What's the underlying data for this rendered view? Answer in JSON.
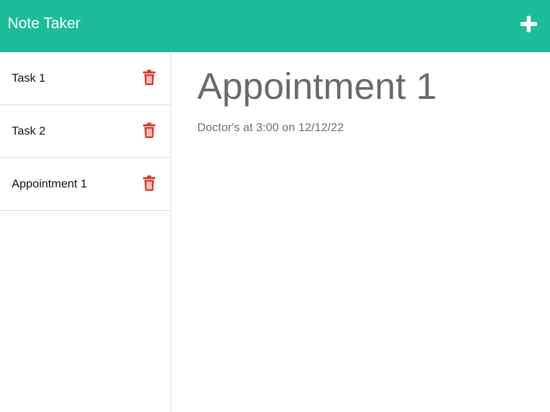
{
  "app": {
    "brand": "Note Taker",
    "new_note_icon": "plus-icon",
    "accent_color": "#1cbc9b",
    "delete_color": "#e03c2c"
  },
  "notes": [
    {
      "title": "Task 1",
      "delete_icon": "trash-icon"
    },
    {
      "title": "Task 2",
      "delete_icon": "trash-icon"
    },
    {
      "title": "Appointment 1",
      "delete_icon": "trash-icon"
    }
  ],
  "active_note": {
    "title": "Appointment 1",
    "text": "Doctor's at 3:00 on 12/12/22"
  }
}
